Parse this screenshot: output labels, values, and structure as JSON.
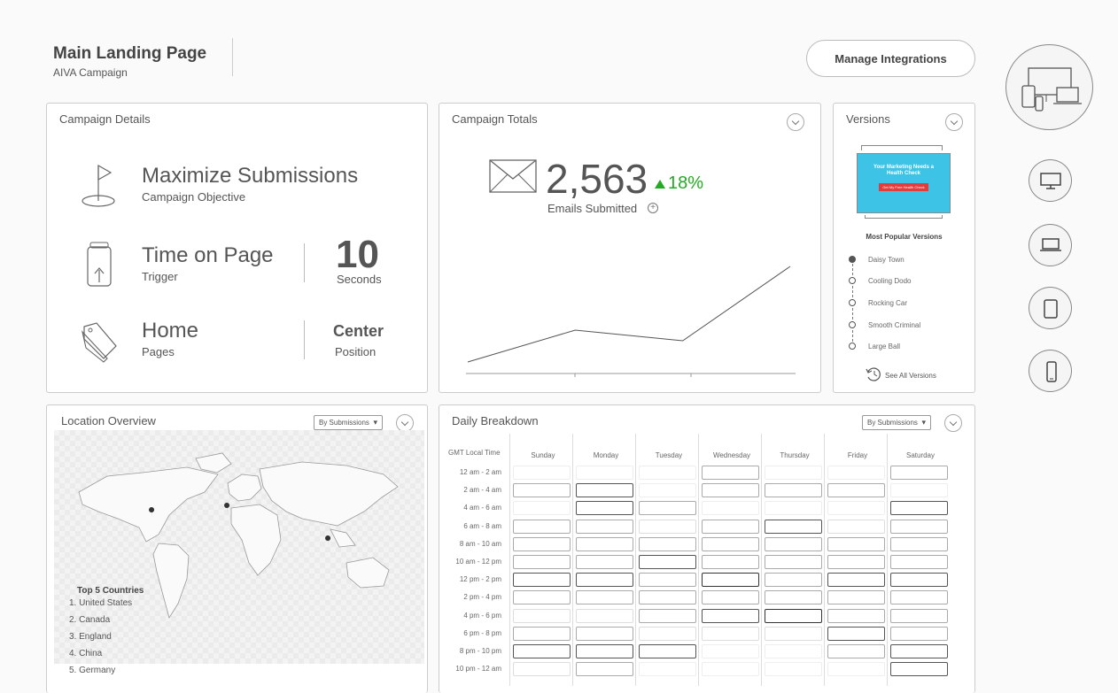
{
  "header": {
    "title": "Main Landing Page",
    "subtitle": "AIVA Campaign",
    "manage_label": "Manage Integrations"
  },
  "campaign_details": {
    "title": "Campaign Details",
    "objective": {
      "value": "Maximize Submissions",
      "label": "Campaign Objective"
    },
    "trigger": {
      "value": "Time on Page",
      "label": "Trigger",
      "amount": "10",
      "unit": "Seconds"
    },
    "pages": {
      "value": "Home",
      "label": "Pages",
      "position": "Center",
      "position_label": "Position"
    }
  },
  "campaign_totals": {
    "title": "Campaign Totals",
    "value": "2,563",
    "change": "18%",
    "label": "Emails Submitted",
    "trend": [
      1,
      4,
      3,
      10
    ],
    "colors": {
      "positive": "#22aa22"
    }
  },
  "versions": {
    "title": "Versions",
    "popular_title": "Most Popular Versions",
    "items": [
      "Daisy Town",
      "Cooling Dodo",
      "Rocking Car",
      "Smooth Criminal",
      "Large Ball"
    ],
    "see_all": "See All Versions",
    "thumb": {
      "headline": "Your Marketing Needs a Health Check",
      "cta": "Get My Free Health Check"
    }
  },
  "devices": [
    "all-devices-icon",
    "desktop-icon",
    "laptop-icon",
    "tablet-icon",
    "phone-icon"
  ],
  "location": {
    "title": "Location Overview",
    "dropdown": "By Submissions",
    "top5_title": "Top 5 Countries",
    "countries": [
      "1.  United States",
      "2. Canada",
      "3. England",
      "4. China",
      "5. Germany"
    ]
  },
  "daily": {
    "title": "Daily Breakdown",
    "dropdown": "By Submissions",
    "time_header": "GMT Local Time",
    "days": [
      "Sunday",
      "Monday",
      "Tuesday",
      "Wednesday",
      "Thursday",
      "Friday",
      "Saturday"
    ],
    "times": [
      "12 am - 2 am",
      "2 am - 4 am",
      "4 am - 6 am",
      "6 am - 8 am",
      "8 am - 10 am",
      "10 am - 12 pm",
      "12 pm - 2 pm",
      "2 pm - 4 pm",
      "4 pm - 6 pm",
      "6 pm - 8 pm",
      "8 pm - 10 pm",
      "10 pm - 12 am"
    ],
    "levels": [
      [
        0,
        0,
        0,
        2,
        0,
        0,
        2
      ],
      [
        2,
        3,
        0,
        2,
        2,
        2,
        0
      ],
      [
        0,
        3,
        2,
        0,
        0,
        0,
        3
      ],
      [
        2,
        2,
        1,
        2,
        3,
        1,
        2
      ],
      [
        2,
        2,
        2,
        2,
        2,
        2,
        2
      ],
      [
        2,
        2,
        3,
        2,
        2,
        2,
        2
      ],
      [
        3,
        3,
        2,
        4,
        2,
        3,
        3
      ],
      [
        2,
        2,
        2,
        2,
        2,
        2,
        2
      ],
      [
        1,
        1,
        2,
        3,
        4,
        2,
        2
      ],
      [
        2,
        2,
        1,
        1,
        1,
        3,
        2
      ],
      [
        3,
        3,
        3,
        0,
        0,
        2,
        3
      ],
      [
        1,
        2,
        0,
        0,
        0,
        0,
        3
      ]
    ]
  }
}
